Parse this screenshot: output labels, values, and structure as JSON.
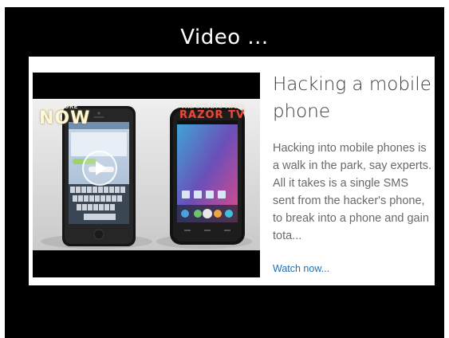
{
  "header": {
    "title": "Video ..."
  },
  "video_card": {
    "title": "Hacking a mobile phone",
    "summary": "Hacking into mobile phones is a walk in the park, say experts. All it takes is a single SMS sent from the hacker's phone, to break into a phone and gain tota...",
    "link_label": "Watch now...",
    "thumbnail": {
      "logo_left_small": "SINGAPORE",
      "logo_left_big": "NOW",
      "logo_right_small": "THE STRAITS TIMES",
      "logo_right_big": "RAZOR TV"
    }
  },
  "colors": {
    "background": "#000000",
    "card": "#ffffff",
    "title_text": "#3a3a3a",
    "summary_text": "#6a6a6a",
    "link": "#1f6fb5"
  }
}
